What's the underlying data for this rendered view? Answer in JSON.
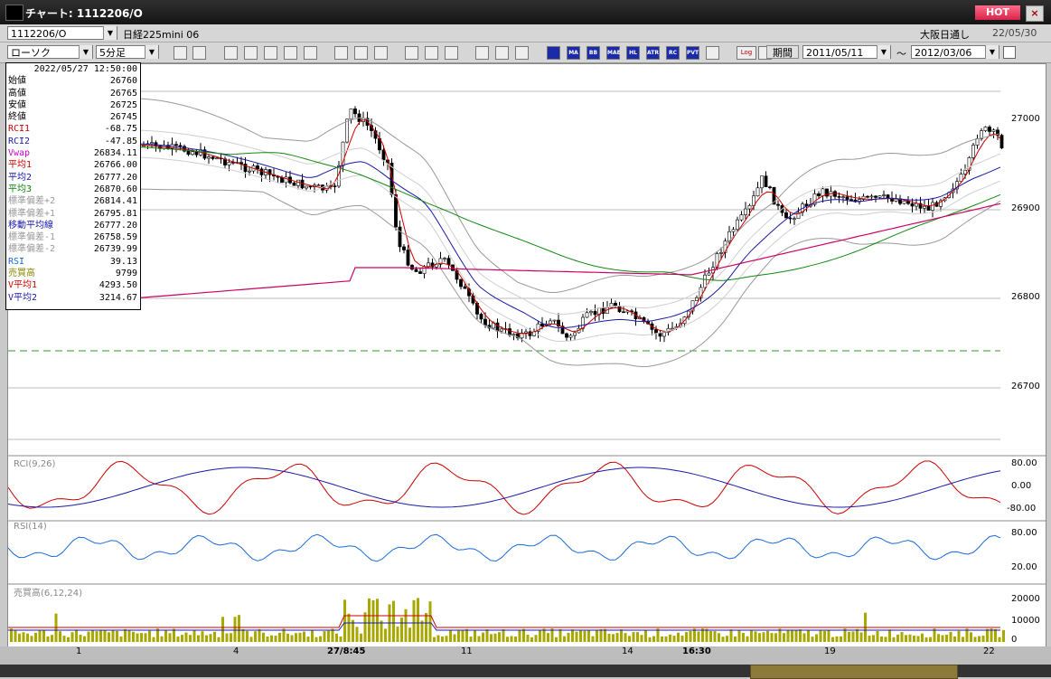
{
  "window": {
    "title": "チャート: 1112206/O",
    "hot_label": "HOT",
    "close_label": "×"
  },
  "toolbar1": {
    "symbol_value": "1112206/O",
    "instrument": "日経225mini 06",
    "session": "大阪日通し",
    "date": "22/05/30"
  },
  "toolbar2": {
    "chart_type": "ローソク",
    "interval": "5分足",
    "period_label": "期間",
    "start_date": "2011/05/11",
    "tilde": "〜",
    "end_date": "2012/03/06",
    "indicator_buttons": [
      "MA",
      "BB",
      "MAE",
      "HL",
      "ATR",
      "RC",
      "PVT"
    ],
    "log_label": "Log"
  },
  "info": {
    "timestamp": "2022/05/27  12:50:00",
    "rows": [
      {
        "k": "始値",
        "v": "26760",
        "c": "#000000"
      },
      {
        "k": "高値",
        "v": "26765",
        "c": "#000000"
      },
      {
        "k": "安値",
        "v": "26725",
        "c": "#000000"
      },
      {
        "k": "終値",
        "v": "26745",
        "c": "#000000"
      },
      {
        "k": "RCI1",
        "v": "-68.75",
        "c": "#cc0000"
      },
      {
        "k": "RCI2",
        "v": "-47.85",
        "c": "#1a1aa8"
      },
      {
        "k": "Vwap",
        "v": "26834.11",
        "c": "#cc00cc"
      },
      {
        "k": "平均1",
        "v": "26766.00",
        "c": "#cc0000"
      },
      {
        "k": "平均2",
        "v": "26777.20",
        "c": "#1a1aa8"
      },
      {
        "k": "平均3",
        "v": "26870.60",
        "c": "#118811"
      },
      {
        "k": "標準偏差+2",
        "v": "26814.41",
        "c": "#999999"
      },
      {
        "k": "標準偏差+1",
        "v": "26795.81",
        "c": "#999999"
      },
      {
        "k": "移動平均線",
        "v": "26777.20",
        "c": "#1a1aa8"
      },
      {
        "k": "標準偏差-1",
        "v": "26758.59",
        "c": "#999999"
      },
      {
        "k": "標準偏差-2",
        "v": "26739.99",
        "c": "#999999"
      },
      {
        "k": "RSI",
        "v": "39.13",
        "c": "#1a6ad8"
      },
      {
        "k": "売買高",
        "v": "9799",
        "c": "#888800"
      },
      {
        "k": "V平均1",
        "v": "4293.50",
        "c": "#cc0000"
      },
      {
        "k": "V平均2",
        "v": "3214.67",
        "c": "#1a1aa8"
      }
    ]
  },
  "axes": {
    "price_ticks": [
      "27000",
      "26900",
      "26800",
      "26700"
    ],
    "rci_label": "RCI(9,26)",
    "rci_ticks": [
      "80.00",
      "0.00",
      "-80.00"
    ],
    "rsi_label": "RSI(14)",
    "rsi_ticks": [
      "80.00",
      "20.00"
    ],
    "vol_label": "売買高(6,12,24)",
    "vol_ticks": [
      "20000",
      "10000",
      "0"
    ],
    "x_ticks": [
      "1",
      "4",
      "27/8:45",
      "11",
      "14",
      "16:30",
      "19",
      "22"
    ]
  },
  "colors": {
    "up": "#ffffff",
    "down": "#000000",
    "ma1": "#cc0000",
    "ma2": "#1a1aa8",
    "ma3": "#118811",
    "vwap": "#cc0066",
    "band": "#999999",
    "rsi": "#1a6ad8",
    "vol": "#a8a800"
  }
}
